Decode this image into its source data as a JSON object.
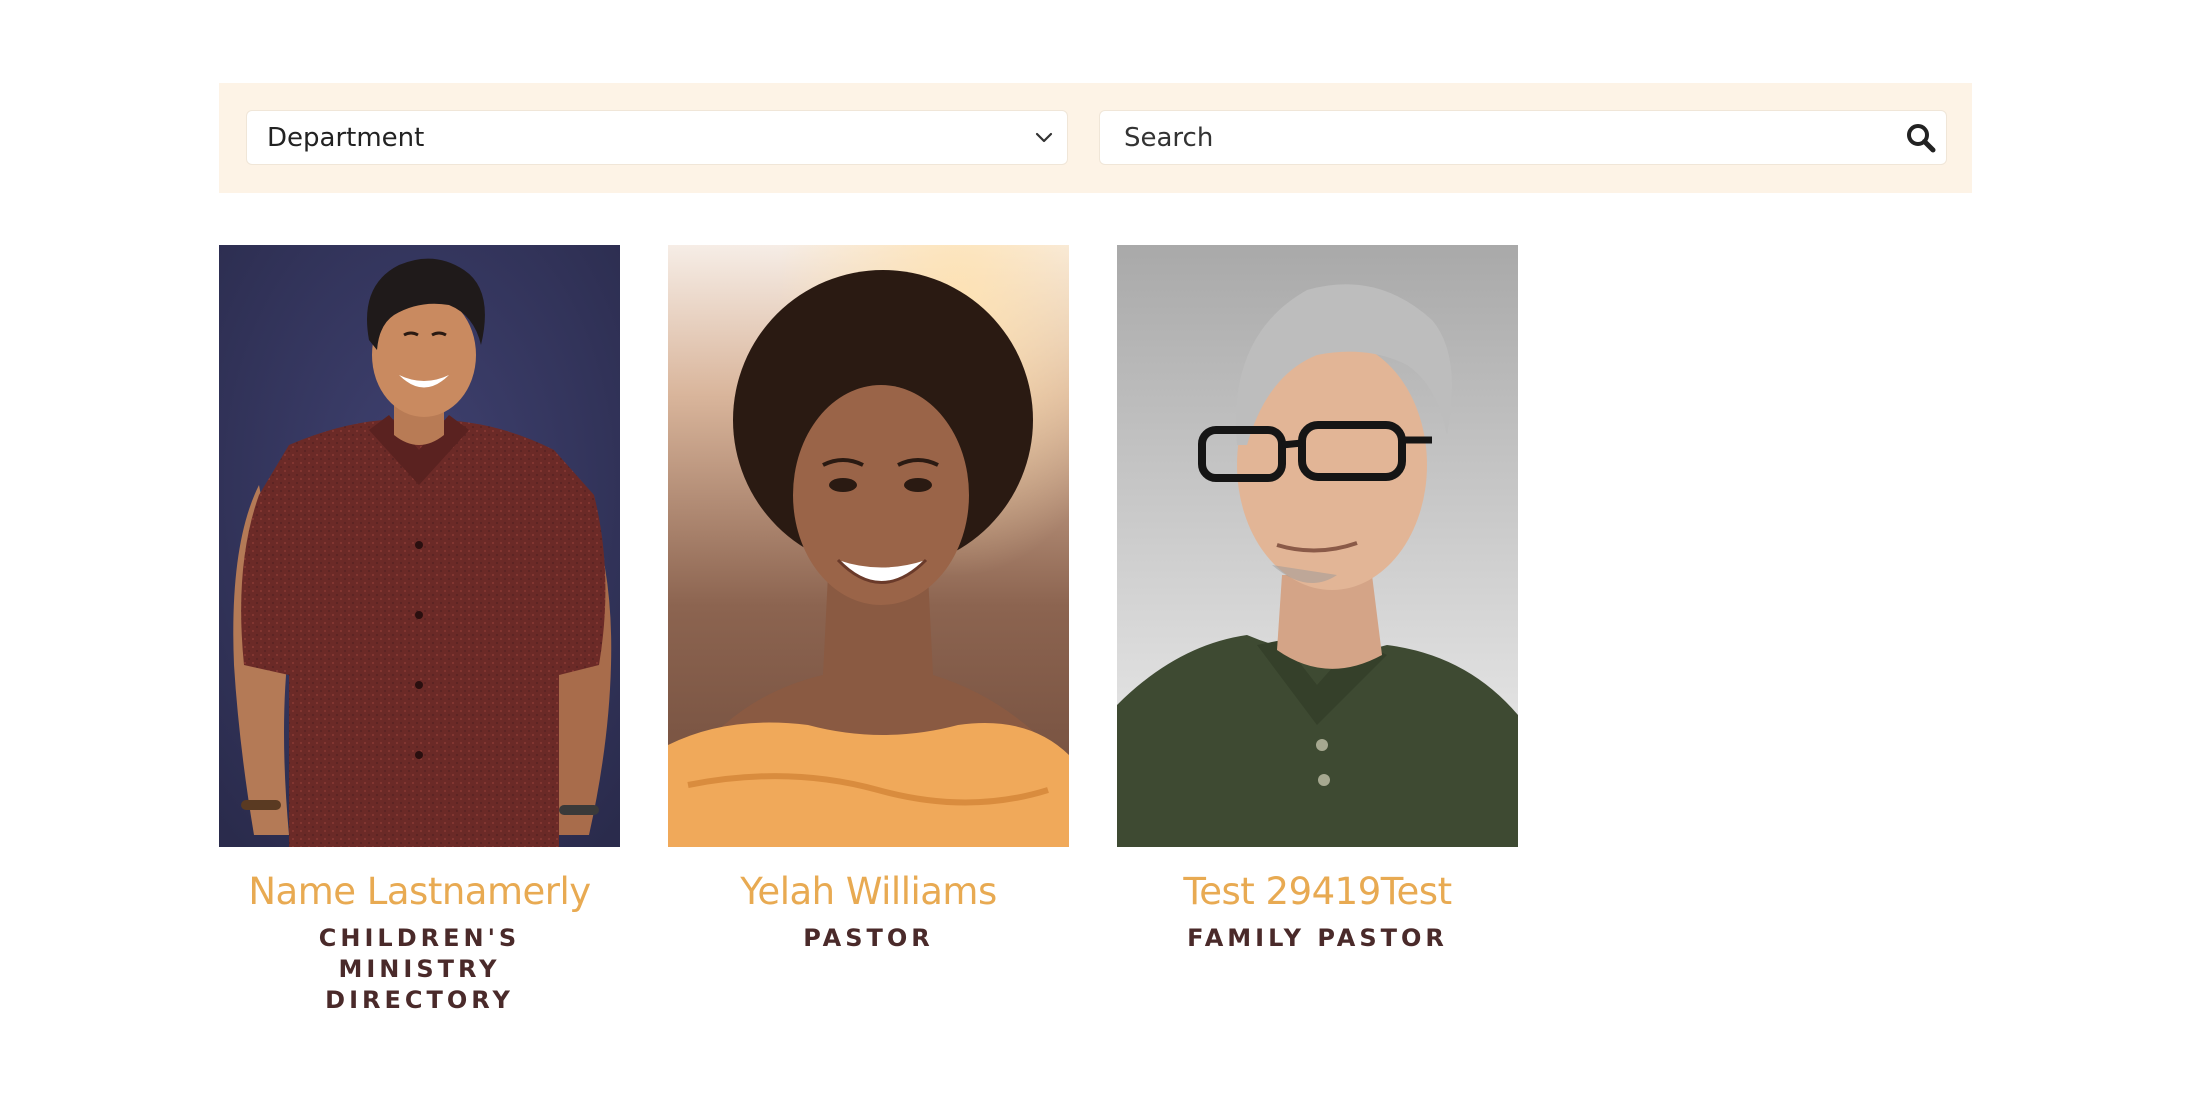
{
  "filters": {
    "department_label": "Department",
    "search_placeholder": "Search"
  },
  "staff": [
    {
      "name": "Name Lastnamerly",
      "title": "CHILDREN'S MINISTRY DIRECTORY"
    },
    {
      "name": "Yelah Williams",
      "title": "PASTOR"
    },
    {
      "name": "Test 29419Test",
      "title": "FAMILY PASTOR"
    }
  ],
  "colors": {
    "filter_bar_bg": "#fdf3e6",
    "name_accent": "#e8aa52",
    "title_text": "#4a2a2a"
  }
}
